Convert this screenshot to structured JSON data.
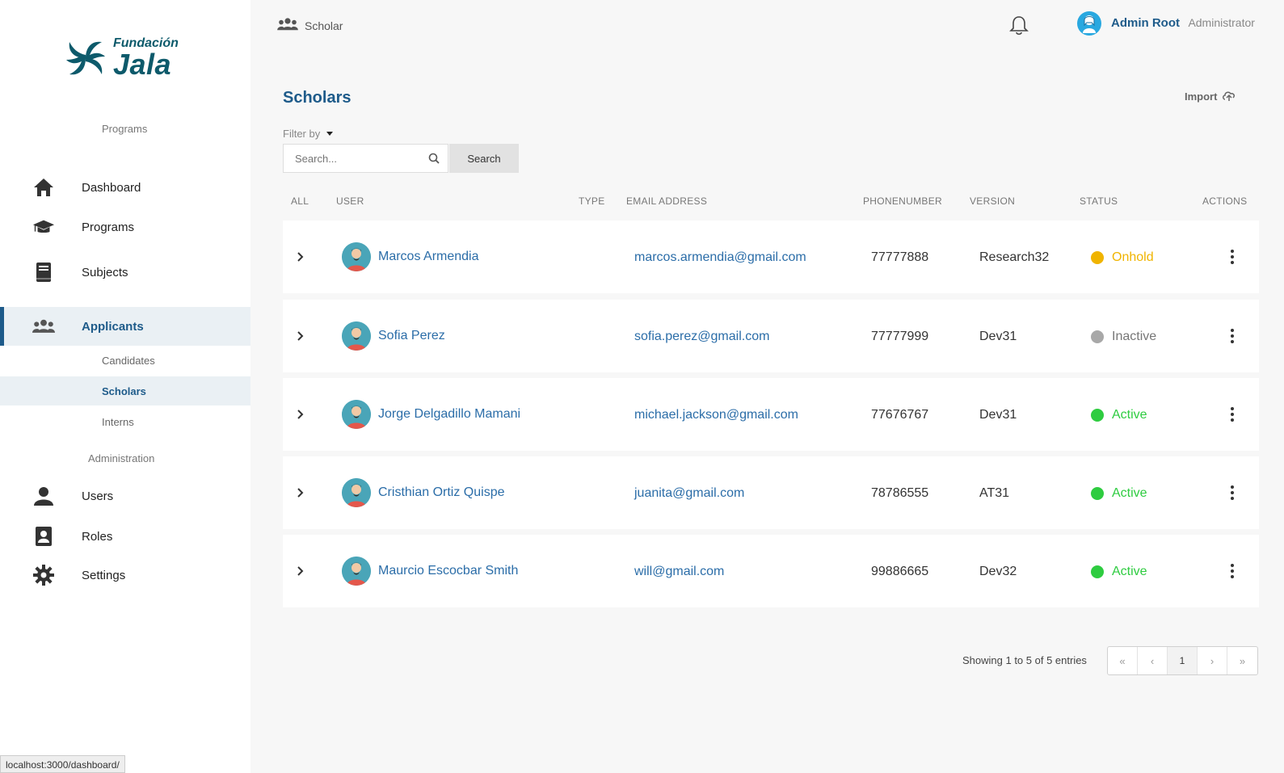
{
  "sidebar": {
    "logo": {
      "top": "Fundación",
      "main": "Jala"
    },
    "programs_label": "Programs",
    "admin_label": "Administration",
    "items": {
      "dashboard": "Dashboard",
      "programs": "Programs",
      "subjects": "Subjects",
      "applicants": "Applicants",
      "users": "Users",
      "roles": "Roles",
      "settings": "Settings"
    },
    "applicants_sub": {
      "candidates": "Candidates",
      "scholars": "Scholars",
      "interns": "Interns"
    }
  },
  "header": {
    "breadcrumb": "Scholar",
    "user_name": "Admin Root",
    "user_role": "Administrator"
  },
  "page": {
    "title": "Scholars",
    "import_label": "Import",
    "filter_label": "Filter by",
    "search_placeholder": "Search...",
    "search_button": "Search"
  },
  "table": {
    "headers": {
      "all": "ALL",
      "user": "USER",
      "type": "TYPE",
      "email": "EMAIL ADDRESS",
      "phone": "PHONENUMBER",
      "version": "VERSION",
      "status": "STATUS",
      "actions": "ACTIONS"
    },
    "rows": [
      {
        "name": "Marcos Armendia",
        "email": "marcos.armendia@gmail.com",
        "phone": "77777888",
        "version": "Research32",
        "status": "Onhold",
        "status_color": "#f0b400"
      },
      {
        "name": "Sofia Perez",
        "email": "sofia.perez@gmail.com",
        "phone": "77777999",
        "version": "Dev31",
        "status": "Inactive",
        "status_color": "#a8a8a8"
      },
      {
        "name": "Jorge Delgadillo Mamani",
        "email": "michael.jackson@gmail.com",
        "phone": "77676767",
        "version": "Dev31",
        "status": "Active",
        "status_color": "#2ecc40"
      },
      {
        "name": "Cristhian Ortiz Quispe",
        "email": "juanita@gmail.com",
        "phone": "78786555",
        "version": "AT31",
        "status": "Active",
        "status_color": "#2ecc40"
      },
      {
        "name": "Maurcio Escocbar Smith",
        "email": "will@gmail.com",
        "phone": "99886665",
        "version": "Dev32",
        "status": "Active",
        "status_color": "#2ecc40"
      }
    ]
  },
  "footer": {
    "showing": "Showing 1 to 5 of 5 entries",
    "pages": {
      "first": "«",
      "prev": "‹",
      "current": "1",
      "next": "›",
      "last": "»"
    }
  },
  "status_bar_url": "localhost:3000/dashboard/",
  "colors": {
    "primary": "#1e5b8a",
    "link": "#2b6da8",
    "logo": "#0d5a6b"
  }
}
